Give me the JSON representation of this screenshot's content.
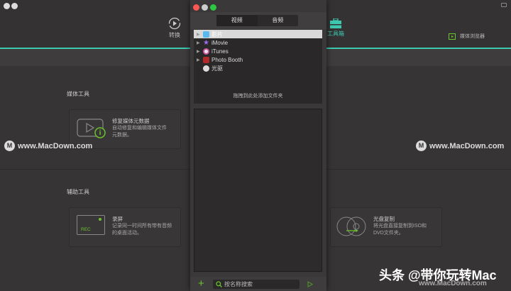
{
  "nav": {
    "convert": "转换",
    "toolbox": "工具箱",
    "media_browser": "媒体浏览器"
  },
  "sections": {
    "media_tools": "媒体工具",
    "aux_tools": "辅助工具"
  },
  "cards": [
    {
      "title": "修复媒体元数据",
      "desc": "自动修复和编辑媒体文件元数据。"
    },
    {
      "title": "录屏",
      "desc": "记录同一时间所有带有音频的桌面活动。",
      "badge": "REC"
    },
    {
      "title": "光盘复制",
      "desc": "将光盘直接复制到ISO和DVD文件夹。"
    }
  ],
  "watermark": "www.MacDown.com",
  "watermark_bottom": "头条 @带你玩转Mac",
  "popup": {
    "tabs": [
      "视频",
      "音频"
    ],
    "items": [
      {
        "label": "影片",
        "expandable": true,
        "selected": true
      },
      {
        "label": "iMovie",
        "expandable": true
      },
      {
        "label": "iTunes",
        "expandable": true
      },
      {
        "label": "Photo Booth",
        "expandable": true
      },
      {
        "label": "光驱",
        "expandable": false
      }
    ],
    "drop_hint": "拖拽到此处添加文件夹",
    "search_placeholder": "按名称搜索"
  },
  "colors": {
    "accent": "#3cc9b0",
    "green": "#6ac22e"
  }
}
